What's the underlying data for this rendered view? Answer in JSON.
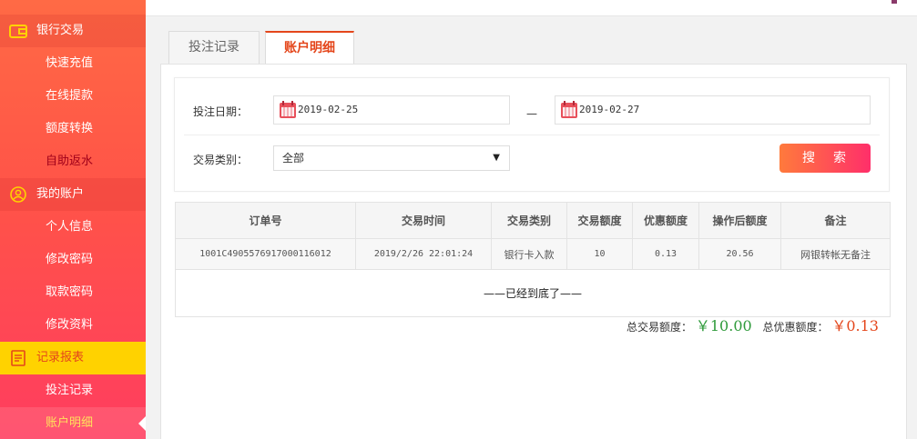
{
  "sidebar": {
    "bank": {
      "title": "银行交易",
      "icon": "wallet-icon",
      "items": [
        "快速充值",
        "在线提款",
        "额度转换",
        "自助返水"
      ]
    },
    "account": {
      "title": "我的账户",
      "icon": "user-icon",
      "items": [
        "个人信息",
        "修改密码",
        "取款密码",
        "修改资料"
      ]
    },
    "records": {
      "title": "记录报表",
      "icon": "report-icon",
      "items": [
        "投注记录",
        "账户明细"
      ]
    }
  },
  "tabs": [
    "投注记录",
    "账户明细"
  ],
  "form": {
    "date_label": "投注日期：",
    "start_date": "2019-02-25",
    "separator": "—",
    "end_date": "2019-02-27",
    "type_label": "交易类别：",
    "type_value": "全部",
    "search_label": "搜索"
  },
  "table": {
    "headers": [
      "订单号",
      "交易时间",
      "交易类别",
      "交易额度",
      "优惠额度",
      "操作后额度",
      "备注"
    ],
    "rows": [
      [
        "1001C4905576917000116012",
        "2019/2/26 22:01:24",
        "银行卡入款",
        "10",
        "0.13",
        "20.56",
        "网银转帐无备注"
      ]
    ],
    "end_text": "——已经到底了——"
  },
  "totals": {
    "trade_label": "总交易额度：",
    "trade_value": "￥10.00",
    "bonus_label": "总优惠额度：",
    "bonus_value": "￥0.13"
  },
  "colors": {
    "accent": "#e4461b",
    "sidebar_top": "#ff6a45",
    "sidebar_bottom": "#ff3d5f",
    "highlight": "#ffd200",
    "green": "#2e9a3a"
  }
}
